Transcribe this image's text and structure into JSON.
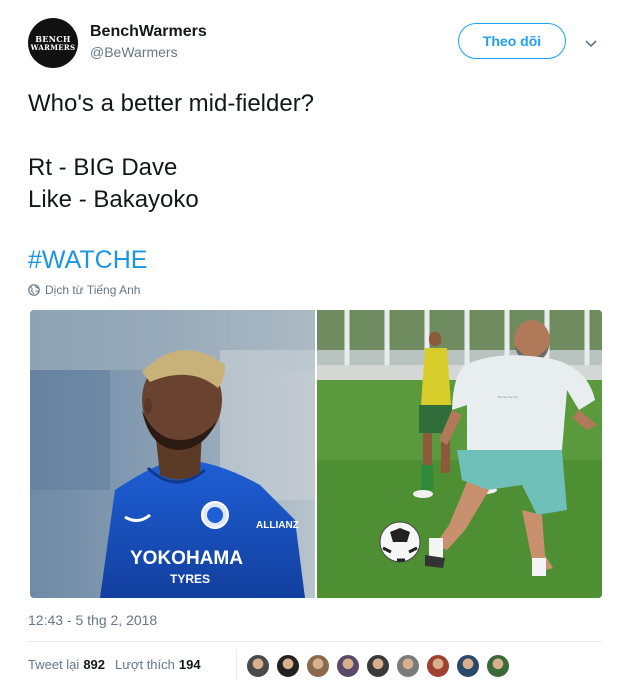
{
  "account": {
    "avatar_text_top": "BENCH",
    "avatar_text_bottom": "WARMERS",
    "display_name": "BenchWarmers",
    "handle": "@BeWarmers"
  },
  "follow_button": {
    "label": "Theo dõi"
  },
  "tweet": {
    "lines": [
      "Who's a better mid-fielder?",
      "",
      "Rt - BIG Dave",
      "Like - Bakayoko"
    ],
    "hashtag": "#WATCHE",
    "translate_label": "Dịch từ Tiếng Anh"
  },
  "media": [
    {
      "name": "player-photo",
      "sponsor_line1": "YOKOHAMA",
      "sponsor_line2": "TYRES",
      "sleeve_text": "ALLIANZ"
    },
    {
      "name": "amateur-player-photo"
    }
  ],
  "timestamp": "12:43 - 5 thg 2, 2018",
  "stats": {
    "retweet_label": "Tweet lại",
    "retweet_count": "892",
    "like_label": "Lượt thích",
    "like_count": "194"
  },
  "likers": [
    "#4a4a4a",
    "#222222",
    "#8a6a4a",
    "#5a4a6a",
    "#3a3a3a",
    "#7a7a7a",
    "#a04030",
    "#2a4a6a",
    "#3a6a3a"
  ],
  "colors": {
    "accent": "#1da1f2",
    "hashtag": "#1b95e0",
    "muted": "#657786"
  }
}
